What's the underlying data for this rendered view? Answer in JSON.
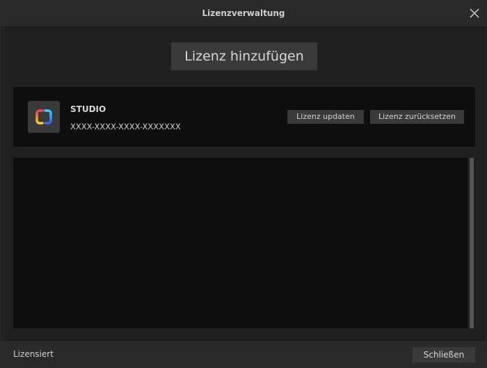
{
  "window": {
    "title": "Lizenzverwaltung"
  },
  "actions": {
    "add_license_label": "Lizenz hinzufügen"
  },
  "license": {
    "product_name": "STUDIO",
    "license_key": "XXXX-XXXX-XXXX-XXXXXXX",
    "update_label": "Lizenz updaten",
    "reset_label": "Lizenz zurücksetzen",
    "icon": "studio-logo-icon"
  },
  "footer": {
    "status": "Lizensiert",
    "close_label": "Schließen"
  },
  "colors": {
    "background": "#202020",
    "titlebar": "#2a2a2a",
    "panel": "#0e0e0e",
    "button": "#3a3a3a",
    "text": "#d6d6d6"
  }
}
